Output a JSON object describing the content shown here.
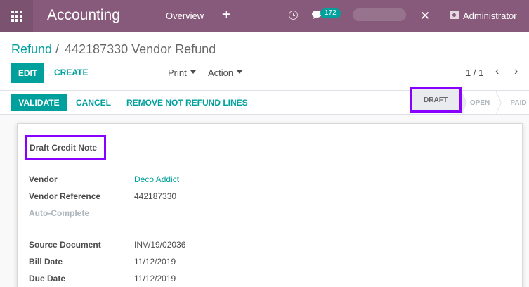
{
  "navbar": {
    "app_name": "Accounting",
    "menu_overview": "Overview",
    "menu_plus": "+",
    "chat_count": "172",
    "user_name": "Administrator"
  },
  "breadcrumb": {
    "parent": "Refund",
    "separator": "/",
    "current": "442187330 Vendor Refund"
  },
  "buttons": {
    "edit": "Edit",
    "create": "Create",
    "print": "Print",
    "action": "Action"
  },
  "pager": {
    "value": "1 / 1",
    "prev": "‹",
    "next": "›"
  },
  "statusbar": {
    "validate": "Validate",
    "cancel": "Cancel",
    "remove_lines": "Remove not refund lines",
    "stages": [
      "Draft",
      "Open",
      "Paid"
    ],
    "active_stage": "Draft"
  },
  "form": {
    "title": "Draft Credit Note",
    "fields": [
      {
        "label": "Vendor",
        "value": "Deco Addict"
      },
      {
        "label": "Vendor Reference",
        "value": "442187330"
      },
      {
        "label": "Auto-Complete",
        "value": ""
      },
      {
        "label": "Source Document",
        "value": "INV/19/02036"
      },
      {
        "label": "Bill Date",
        "value": "11/12/2019"
      },
      {
        "label": "Due Date",
        "value": "11/12/2019"
      }
    ]
  },
  "colors": {
    "brand": "#875a7b",
    "accent": "#00a09d",
    "highlight": "#8800ff"
  }
}
